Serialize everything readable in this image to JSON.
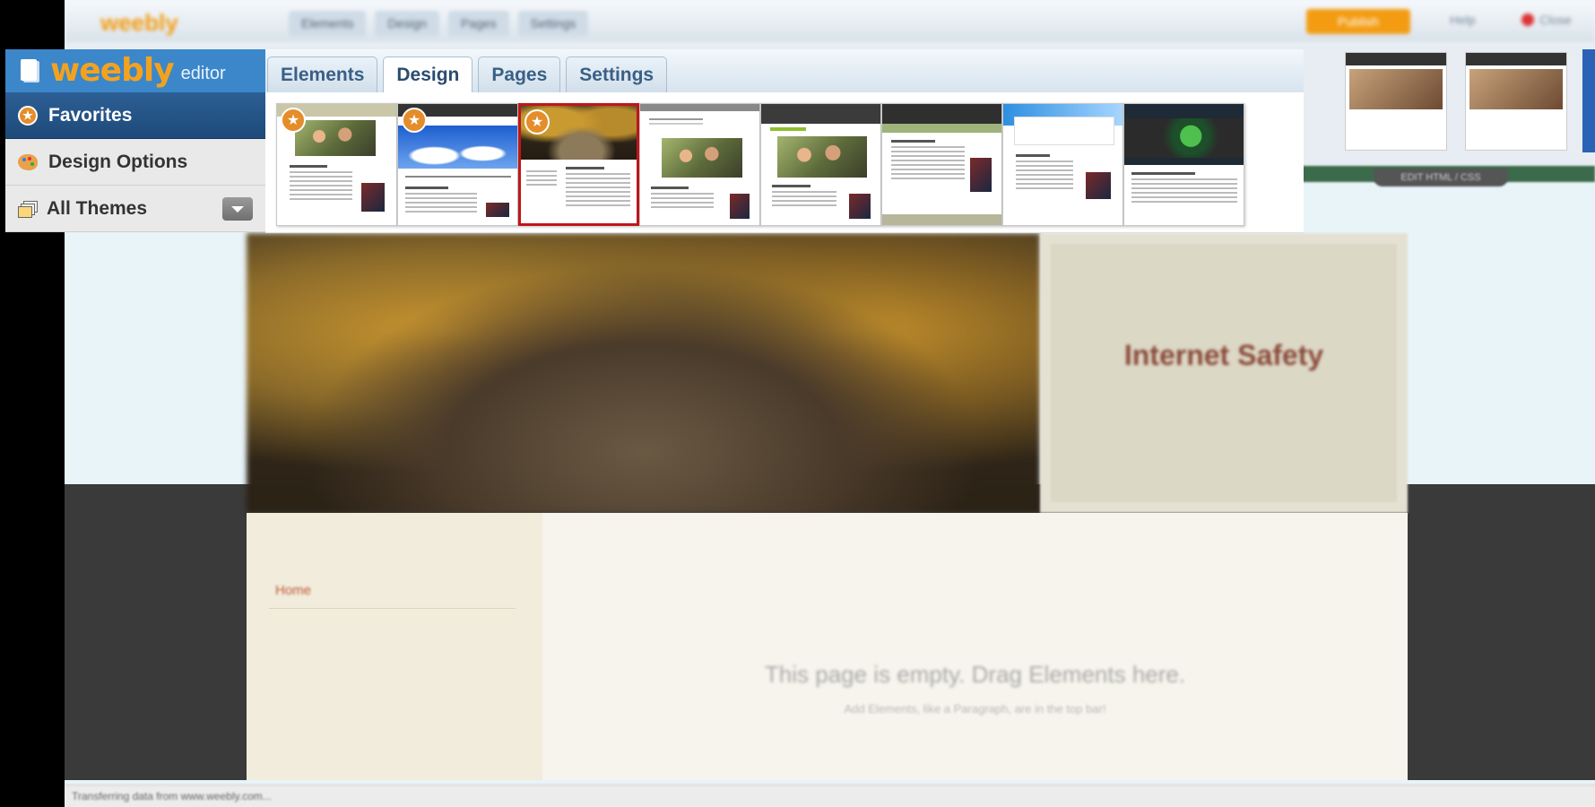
{
  "app": {
    "logo_text": "weebly",
    "logo_sub": "editor"
  },
  "tabs": [
    {
      "label": "Elements",
      "active": false
    },
    {
      "label": "Design",
      "active": true
    },
    {
      "label": "Pages",
      "active": false
    },
    {
      "label": "Settings",
      "active": false
    }
  ],
  "sidebar": {
    "items": [
      {
        "label": "Favorites",
        "icon": "star-icon",
        "active": true
      },
      {
        "label": "Design Options",
        "icon": "palette-icon",
        "active": false
      },
      {
        "label": "All Themes",
        "icon": "themes-icon",
        "active": false
      }
    ]
  },
  "themes": {
    "selected_index": 2,
    "favorites": [
      0,
      1,
      2
    ]
  },
  "background": {
    "publish_label": "Publish",
    "help_label": "Help",
    "close_label": "Close",
    "pill_label": "EDIT HTML / CSS",
    "site_title": "Internet Safety",
    "nav_home": "Home",
    "empty_message": "This page is empty. Drag Elements here.",
    "empty_hint": "Add Elements, like a Paragraph, are in the top bar!",
    "status_text": "Transferring data from www.weebly.com..."
  },
  "colors": {
    "accent_blue": "#3b87ca",
    "sidebar_active": "#1e4a7a",
    "favorite_orange": "#e48d2a",
    "selected_border": "#c0161b",
    "logo_orange": "#f4a21e"
  }
}
